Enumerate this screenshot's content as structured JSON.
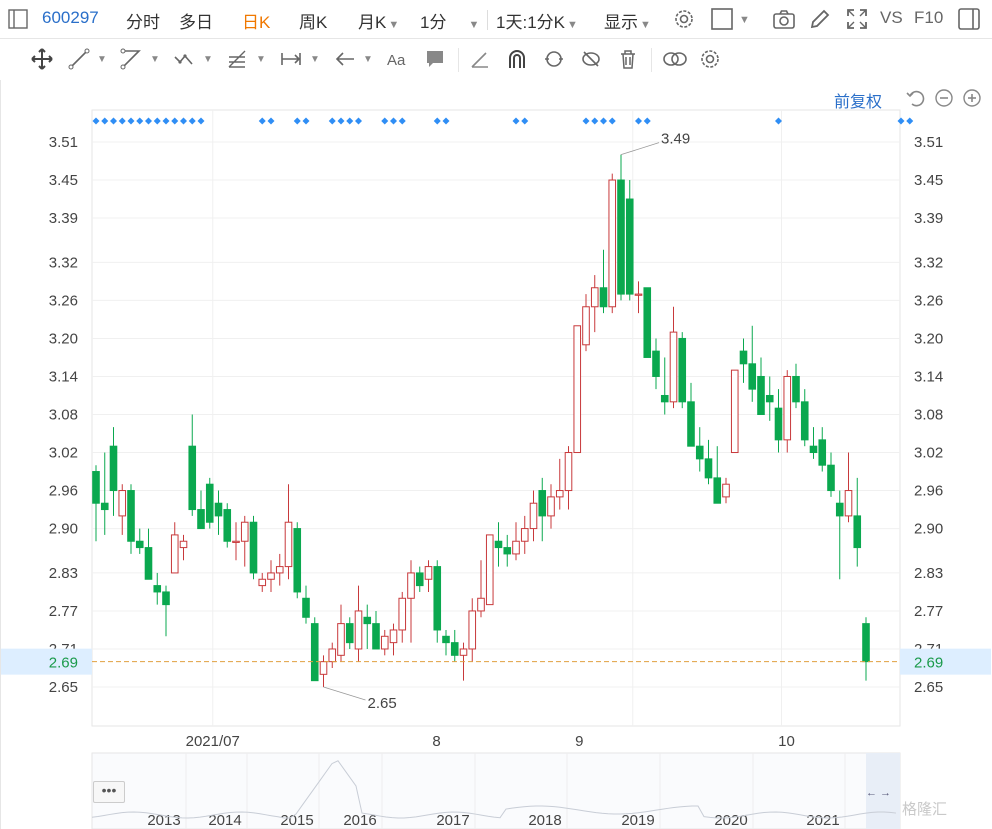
{
  "toolbar": {
    "code": "600297",
    "tabs": [
      "分时",
      "多日",
      "日K",
      "周K",
      "月K",
      "1分"
    ],
    "active_tab": "日K",
    "range": "1天",
    "period": "1分K",
    "display": "显示",
    "vs": "VS",
    "f10": "F10"
  },
  "chart_header": {
    "adjust_label": "前复权"
  },
  "accent_colors": {
    "up": "#c8393b",
    "down": "#0aa84f",
    "signal": "#2f8ef5",
    "current_price_line": "#e0a040",
    "current_price_text": "#1a9a4a"
  },
  "icons": [
    "settings-icon",
    "checkbox-icon",
    "camera-icon",
    "pencil-icon",
    "fullscreen-icon",
    "panel-icon",
    "move-icon",
    "line-icon",
    "channel-icon",
    "wave-icon",
    "fib-icon",
    "measure-icon",
    "arrow-icon",
    "text-icon",
    "comment-icon",
    "angle-icon",
    "magnet-icon",
    "lock-icon",
    "hide-icon",
    "trash-icon",
    "link-icon",
    "gear-icon",
    "undo-icon",
    "zoom-out-icon",
    "zoom-in-icon"
  ],
  "nav": {
    "dots": "•••",
    "years": [
      "2013",
      "2014",
      "2015",
      "2016",
      "2017",
      "2018",
      "2019",
      "2020",
      "2021"
    ],
    "arrows": "← →"
  },
  "watermark": "格隆汇",
  "chart_data": {
    "type": "candlestick",
    "y_ticks": [
      "3.51",
      "3.45",
      "3.39",
      "3.32",
      "3.26",
      "3.20",
      "3.14",
      "3.08",
      "3.02",
      "2.96",
      "2.90",
      "2.83",
      "2.77",
      "2.71",
      "2.65"
    ],
    "x_ticks": [
      "2021/07",
      "8",
      "9",
      "10"
    ],
    "current_price": "2.69",
    "max_label": "3.49",
    "min_label": "2.65",
    "ylim": [
      2.62,
      3.53
    ],
    "signal_rows": [
      [
        0,
        12
      ],
      [
        19,
        20
      ],
      [
        23,
        24
      ],
      [
        27,
        30
      ],
      [
        33,
        35
      ],
      [
        39,
        40
      ],
      [
        48,
        49
      ],
      [
        56,
        59
      ],
      [
        62,
        63
      ],
      [
        78,
        78
      ],
      [
        92,
        93
      ]
    ],
    "candles": [
      [
        2.99,
        3.0,
        2.88,
        2.94
      ],
      [
        2.94,
        3.02,
        2.89,
        2.93
      ],
      [
        3.03,
        3.06,
        2.92,
        2.96
      ],
      [
        2.92,
        2.97,
        2.89,
        2.96
      ],
      [
        2.96,
        2.97,
        2.86,
        2.88
      ],
      [
        2.88,
        2.9,
        2.86,
        2.87
      ],
      [
        2.87,
        2.9,
        2.82,
        2.82
      ],
      [
        2.81,
        2.83,
        2.78,
        2.8
      ],
      [
        2.8,
        2.81,
        2.73,
        2.78
      ],
      [
        2.83,
        2.91,
        2.83,
        2.89
      ],
      [
        2.87,
        2.89,
        2.85,
        2.88
      ],
      [
        3.03,
        3.08,
        2.92,
        2.93
      ],
      [
        2.93,
        2.96,
        2.9,
        2.9
      ],
      [
        2.97,
        2.98,
        2.9,
        2.91
      ],
      [
        2.94,
        2.96,
        2.89,
        2.92
      ],
      [
        2.93,
        2.94,
        2.87,
        2.88
      ],
      [
        2.88,
        2.91,
        2.85,
        2.88
      ],
      [
        2.88,
        2.92,
        2.84,
        2.91
      ],
      [
        2.91,
        2.92,
        2.82,
        2.83
      ],
      [
        2.81,
        2.83,
        2.8,
        2.82
      ],
      [
        2.82,
        2.85,
        2.8,
        2.83
      ],
      [
        2.83,
        2.86,
        2.81,
        2.84
      ],
      [
        2.84,
        2.97,
        2.82,
        2.91
      ],
      [
        2.9,
        2.91,
        2.79,
        2.8
      ],
      [
        2.79,
        2.81,
        2.75,
        2.76
      ],
      [
        2.75,
        2.76,
        2.66,
        2.66
      ],
      [
        2.67,
        2.7,
        2.65,
        2.69
      ],
      [
        2.69,
        2.72,
        2.68,
        2.71
      ],
      [
        2.7,
        2.78,
        2.69,
        2.75
      ],
      [
        2.75,
        2.76,
        2.71,
        2.72
      ],
      [
        2.71,
        2.81,
        2.69,
        2.77
      ],
      [
        2.76,
        2.78,
        2.71,
        2.75
      ],
      [
        2.75,
        2.77,
        2.71,
        2.71
      ],
      [
        2.71,
        2.74,
        2.7,
        2.73
      ],
      [
        2.72,
        2.75,
        2.7,
        2.74
      ],
      [
        2.74,
        2.8,
        2.72,
        2.79
      ],
      [
        2.79,
        2.85,
        2.72,
        2.83
      ],
      [
        2.83,
        2.84,
        2.8,
        2.81
      ],
      [
        2.82,
        2.85,
        2.8,
        2.84
      ],
      [
        2.84,
        2.85,
        2.72,
        2.74
      ],
      [
        2.73,
        2.74,
        2.7,
        2.72
      ],
      [
        2.72,
        2.74,
        2.69,
        2.7
      ],
      [
        2.7,
        2.72,
        2.66,
        2.71
      ],
      [
        2.71,
        2.79,
        2.69,
        2.77
      ],
      [
        2.77,
        2.85,
        2.76,
        2.79
      ],
      [
        2.78,
        2.89,
        2.78,
        2.89
      ],
      [
        2.88,
        2.91,
        2.84,
        2.87
      ],
      [
        2.87,
        2.89,
        2.84,
        2.86
      ],
      [
        2.86,
        2.91,
        2.85,
        2.88
      ],
      [
        2.88,
        2.92,
        2.86,
        2.9
      ],
      [
        2.9,
        2.96,
        2.88,
        2.94
      ],
      [
        2.96,
        2.98,
        2.88,
        2.92
      ],
      [
        2.92,
        2.97,
        2.9,
        2.95
      ],
      [
        2.95,
        3.01,
        2.93,
        2.96
      ],
      [
        2.96,
        3.03,
        2.93,
        3.02
      ],
      [
        3.02,
        3.22,
        3.02,
        3.22
      ],
      [
        3.19,
        3.27,
        3.18,
        3.25
      ],
      [
        3.25,
        3.3,
        3.21,
        3.28
      ],
      [
        3.28,
        3.34,
        3.24,
        3.25
      ],
      [
        3.25,
        3.46,
        3.24,
        3.45
      ],
      [
        3.45,
        3.49,
        3.26,
        3.27
      ],
      [
        3.42,
        3.45,
        3.26,
        3.27
      ],
      [
        3.27,
        3.29,
        3.24,
        3.27
      ],
      [
        3.28,
        3.28,
        3.18,
        3.17
      ],
      [
        3.18,
        3.2,
        3.12,
        3.14
      ],
      [
        3.11,
        3.17,
        3.08,
        3.1
      ],
      [
        3.1,
        3.25,
        3.09,
        3.21
      ],
      [
        3.2,
        3.21,
        3.09,
        3.1
      ],
      [
        3.1,
        3.13,
        3.03,
        3.03
      ],
      [
        3.03,
        3.06,
        2.99,
        3.01
      ],
      [
        3.01,
        3.04,
        2.97,
        2.98
      ],
      [
        2.98,
        3.03,
        2.95,
        2.94
      ],
      [
        2.95,
        2.98,
        2.94,
        2.97
      ],
      [
        3.02,
        3.15,
        3.02,
        3.15
      ],
      [
        3.18,
        3.2,
        3.13,
        3.16
      ],
      [
        3.16,
        3.22,
        3.1,
        3.12
      ],
      [
        3.14,
        3.17,
        3.08,
        3.08
      ],
      [
        3.11,
        3.14,
        3.07,
        3.1
      ],
      [
        3.09,
        3.12,
        3.02,
        3.04
      ],
      [
        3.04,
        3.15,
        3.02,
        3.14
      ],
      [
        3.14,
        3.16,
        3.09,
        3.1
      ],
      [
        3.1,
        3.12,
        3.03,
        3.04
      ],
      [
        3.03,
        3.06,
        3.01,
        3.02
      ],
      [
        3.04,
        3.06,
        2.99,
        3.0
      ],
      [
        3.0,
        3.02,
        2.95,
        2.96
      ],
      [
        2.94,
        2.96,
        2.82,
        2.92
      ],
      [
        2.92,
        3.02,
        2.91,
        2.96
      ],
      [
        2.92,
        2.98,
        2.84,
        2.87
      ],
      [
        2.75,
        2.76,
        2.66,
        2.69
      ]
    ]
  }
}
